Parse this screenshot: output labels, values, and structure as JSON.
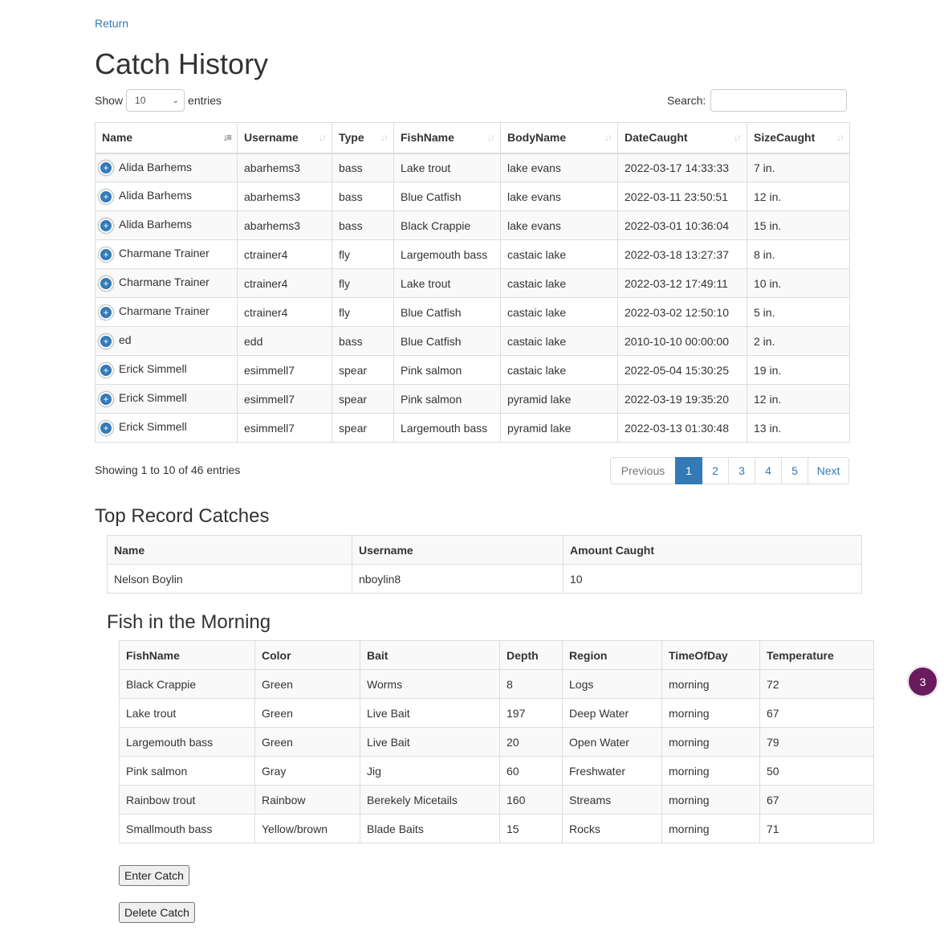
{
  "return_label": "Return",
  "page_title": "Catch History",
  "length": {
    "show": "Show",
    "value": "10",
    "entries": "entries"
  },
  "search": {
    "label": "Search:",
    "value": ""
  },
  "catch_table": {
    "columns": [
      "Name",
      "Username",
      "Type",
      "FishName",
      "BodyName",
      "DateCaught",
      "SizeCaught"
    ],
    "sorted_column": "Name",
    "rows": [
      [
        "Alida Barhems",
        "abarhems3",
        "bass",
        "Lake trout",
        "lake evans",
        "2022-03-17 14:33:33",
        "7 in."
      ],
      [
        "Alida Barhems",
        "abarhems3",
        "bass",
        "Blue Catfish",
        "lake evans",
        "2022-03-11 23:50:51",
        "12 in."
      ],
      [
        "Alida Barhems",
        "abarhems3",
        "bass",
        "Black Crappie",
        "lake evans",
        "2022-03-01 10:36:04",
        "15 in."
      ],
      [
        "Charmane Trainer",
        "ctrainer4",
        "fly",
        "Largemouth bass",
        "castaic lake",
        "2022-03-18 13:27:37",
        "8 in."
      ],
      [
        "Charmane Trainer",
        "ctrainer4",
        "fly",
        "Lake trout",
        "castaic lake",
        "2022-03-12 17:49:11",
        "10 in."
      ],
      [
        "Charmane Trainer",
        "ctrainer4",
        "fly",
        "Blue Catfish",
        "castaic lake",
        "2022-03-02 12:50:10",
        "5 in."
      ],
      [
        "ed",
        "edd",
        "bass",
        "Blue Catfish",
        "castaic lake",
        "2010-10-10 00:00:00",
        "2 in."
      ],
      [
        "Erick Simmell",
        "esimmell7",
        "spear",
        "Pink salmon",
        "castaic lake",
        "2022-05-04 15:30:25",
        "19 in."
      ],
      [
        "Erick Simmell",
        "esimmell7",
        "spear",
        "Pink salmon",
        "pyramid lake",
        "2022-03-19 19:35:20",
        "12 in."
      ],
      [
        "Erick Simmell",
        "esimmell7",
        "spear",
        "Largemouth bass",
        "pyramid lake",
        "2022-03-13 01:30:48",
        "13 in."
      ]
    ]
  },
  "info_text": "Showing 1 to 10 of 46 entries",
  "pagination": {
    "previous": "Previous",
    "pages": [
      "1",
      "2",
      "3",
      "4",
      "5"
    ],
    "active_page": "1",
    "next": "Next"
  },
  "records": {
    "title": "Top Record Catches",
    "columns": [
      "Name",
      "Username",
      "Amount Caught"
    ],
    "rows": [
      [
        "Nelson Boylin",
        "nboylin8",
        "10"
      ]
    ]
  },
  "morning": {
    "title": "Fish in the Morning",
    "columns": [
      "FishName",
      "Color",
      "Bait",
      "Depth",
      "Region",
      "TimeOfDay",
      "Temperature"
    ],
    "rows": [
      [
        "Black Crappie",
        "Green",
        "Worms",
        "8",
        "Logs",
        "morning",
        "72"
      ],
      [
        "Lake trout",
        "Green",
        "Live Bait",
        "197",
        "Deep Water",
        "morning",
        "67"
      ],
      [
        "Largemouth bass",
        "Green",
        "Live Bait",
        "20",
        "Open Water",
        "morning",
        "79"
      ],
      [
        "Pink salmon",
        "Gray",
        "Jig",
        "60",
        "Freshwater",
        "morning",
        "50"
      ],
      [
        "Rainbow trout",
        "Rainbow",
        "Berekely Micetails",
        "160",
        "Streams",
        "morning",
        "67"
      ],
      [
        "Smallmouth bass",
        "Yellow/brown",
        "Blade Baits",
        "15",
        "Rocks",
        "morning",
        "71"
      ]
    ]
  },
  "buttons": {
    "enter": "Enter Catch",
    "delete": "Delete Catch"
  },
  "badge": "3",
  "colors": {
    "link": "#337ab7",
    "active_page": "#337ab7",
    "badge": "#6a1b5e"
  },
  "icons": {
    "expand": "plus-circle-icon",
    "sort": "sort-arrows-icon",
    "sort_active": "sort-alpha-icon",
    "select": "chevron-down-icon"
  }
}
